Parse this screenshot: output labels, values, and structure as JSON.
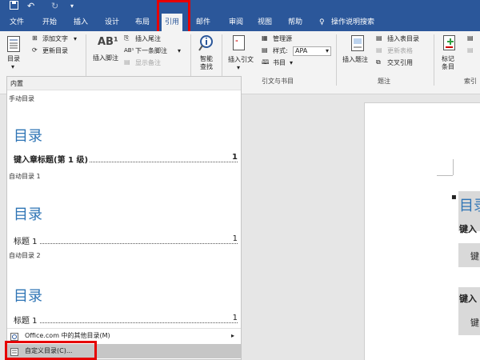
{
  "titlebar": {
    "undo_glyph": "↶",
    "redo_glyph": "↻"
  },
  "tabs": [
    {
      "label": "文件"
    },
    {
      "label": "开始"
    },
    {
      "label": "插入"
    },
    {
      "label": "设计"
    },
    {
      "label": "布局"
    },
    {
      "label": "引用"
    },
    {
      "label": "邮件"
    },
    {
      "label": "审阅"
    },
    {
      "label": "视图"
    },
    {
      "label": "帮助"
    },
    {
      "label": "操作说明搜索"
    }
  ],
  "ribbon": {
    "toc": {
      "button": "目录",
      "add_text": "添加文字",
      "update_toc": "更新目录"
    },
    "footnotes": {
      "insert_footnote": "插入脚注",
      "insert_endnote": "插入尾注",
      "next_footnote": "下一条脚注",
      "show_notes": "显示备注"
    },
    "research": {
      "smart_lookup": "智能查找",
      "smart_lookup_line1": "智能",
      "smart_lookup_line2": "查找"
    },
    "citations": {
      "insert_citation": "插入引文",
      "manage_sources": "管理源",
      "style_label": "样式:",
      "style_value": "APA",
      "bibliography": "书目",
      "group_label": "引文与书目"
    },
    "captions": {
      "insert_caption": "插入题注",
      "insert_table_of_figures": "插入表目录",
      "update_table": "更新表格",
      "cross_reference": "交叉引用",
      "group_label": "题注"
    },
    "index": {
      "mark_entry_line1": "标记",
      "mark_entry_line2": "条目",
      "group_label": "索引"
    }
  },
  "gallery": {
    "header": "内置",
    "sections": [
      {
        "title": "手动目录",
        "heading": "目录",
        "line": "键入章标题(第 1 级)",
        "page": "1"
      },
      {
        "title": "自动目录 1",
        "heading": "目录",
        "line": "标题 1",
        "page": "1"
      },
      {
        "title": "自动目录 2",
        "heading": "目录",
        "line": "标题 1",
        "page": "1"
      }
    ],
    "more_toc": "Office.com 中的其他目录(M)",
    "custom_toc": "自定义目录(C)..."
  },
  "document": {
    "toc_heading": "目录",
    "entry1": "键入",
    "entry2": "键",
    "entry3": "键入",
    "entry4": "键"
  }
}
